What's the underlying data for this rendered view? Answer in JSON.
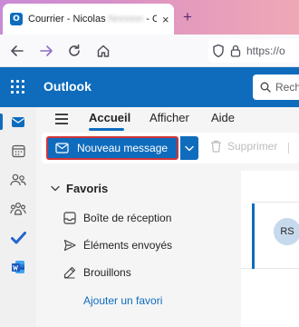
{
  "browser": {
    "tab": {
      "favicon_letter": "O",
      "title_prefix": "Courrier - Nicolas ",
      "title_redacted": "Nnnnnn",
      "title_suffix": " - Outl",
      "close": "×"
    },
    "new_tab": "+",
    "url": "https://o"
  },
  "outlook": {
    "app_title": "Outlook",
    "search_placeholder": "Rech",
    "menu": {
      "tabs": [
        {
          "label": "Accueil",
          "active": true
        },
        {
          "label": "Afficher",
          "active": false
        },
        {
          "label": "Aide",
          "active": false
        }
      ]
    },
    "ribbon": {
      "new_message": "Nouveau message",
      "delete": "Supprimer"
    },
    "folders": {
      "section": "Favoris",
      "items": [
        {
          "label": "Boîte de réception",
          "icon": "inbox-icon"
        },
        {
          "label": "Éléments envoyés",
          "icon": "send-icon"
        },
        {
          "label": "Brouillons",
          "icon": "pencil-icon"
        }
      ],
      "add_favorite": "Ajouter un favori"
    },
    "message_list": {
      "first_avatar": "RS"
    },
    "rail": {
      "items": [
        "mail-icon",
        "calendar-icon",
        "people-icon",
        "groups-icon",
        "todo-icon",
        "word-icon"
      ]
    }
  },
  "colors": {
    "brand": "#0f6cbd",
    "highlight": "#d13438"
  }
}
